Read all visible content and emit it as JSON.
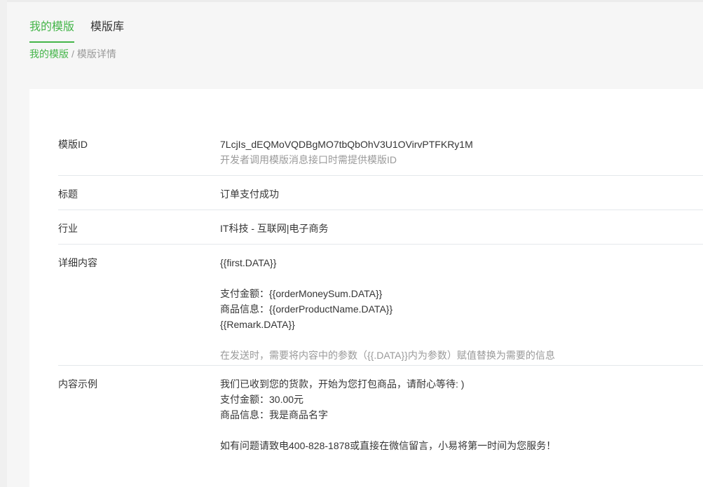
{
  "tabs": [
    {
      "label": "我的模版",
      "active": true
    },
    {
      "label": "模版库",
      "active": false
    }
  ],
  "breadcrumb": {
    "parent": "我的模版",
    "separator": "/",
    "current": "模版详情"
  },
  "details": {
    "template_id": {
      "label": "模版ID",
      "value": "7LcjIs_dEQMoVQDBgMO7tbQbOhV3U1OVirvPTFKRy1M",
      "tip": "开发者调用模版消息接口时需提供模版ID"
    },
    "title": {
      "label": "标题",
      "value": "订单支付成功"
    },
    "industry": {
      "label": "行业",
      "value": "IT科技 - 互联网|电子商务"
    },
    "content": {
      "label": "详细内容",
      "lines": [
        "{{first.DATA}}",
        "支付金额：{{orderMoneySum.DATA}}",
        "商品信息：{{orderProductName.DATA}}",
        "{{Remark.DATA}}"
      ],
      "tip": "在发送时，需要将内容中的参数（{{.DATA}}内为参数）赋值替换为需要的信息"
    },
    "example": {
      "label": "内容示例",
      "lines": [
        "我们已收到您的货款，开始为您打包商品，请耐心等待: )",
        "支付金额：30.00元",
        "商品信息：我是商品名字",
        "如有问题请致电400-828-1878或直接在微信留言，小易将第一时间为您服务！"
      ]
    }
  },
  "colors": {
    "accent": "#44b549",
    "text": "#353535",
    "muted": "#9a9a9a",
    "divider": "#e4e8eb",
    "page_bg": "#f6f6f6"
  }
}
